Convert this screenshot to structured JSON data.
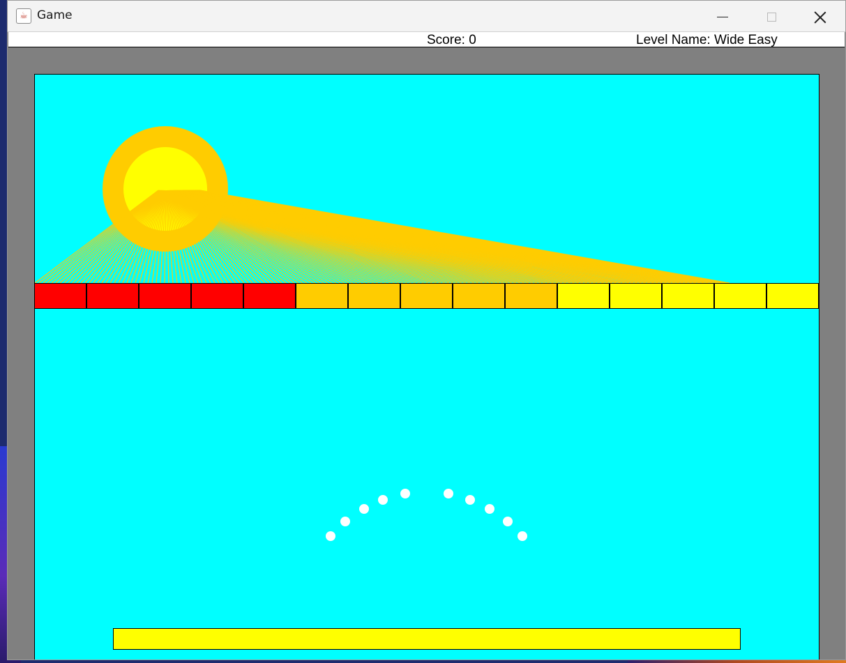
{
  "window": {
    "title": "Game"
  },
  "hud": {
    "score": "Score: 0",
    "level_name": "Level Name: Wide Easy"
  },
  "colors": {
    "background": "#00ffff",
    "frame": "#808080",
    "sun_outer": "#ffcc00",
    "sun_inner": "#ffff00",
    "paddle": "#ffff00",
    "ball": "#ffffff"
  },
  "bricks": [
    {
      "color": "#ff0000"
    },
    {
      "color": "#ff0000"
    },
    {
      "color": "#ff0000"
    },
    {
      "color": "#ff0000"
    },
    {
      "color": "#ff0000"
    },
    {
      "color": "#ffcc00"
    },
    {
      "color": "#ffcc00"
    },
    {
      "color": "#ffcc00"
    },
    {
      "color": "#ffcc00"
    },
    {
      "color": "#ffcc00"
    },
    {
      "color": "#ffff00"
    },
    {
      "color": "#ffff00"
    },
    {
      "color": "#ffff00"
    },
    {
      "color": "#ffff00"
    },
    {
      "color": "#ffff00"
    }
  ],
  "balls_count": 10,
  "icons": {
    "app": "java-cup-icon",
    "minimize": "minimize-icon",
    "maximize": "maximize-icon",
    "close": "close-icon"
  }
}
